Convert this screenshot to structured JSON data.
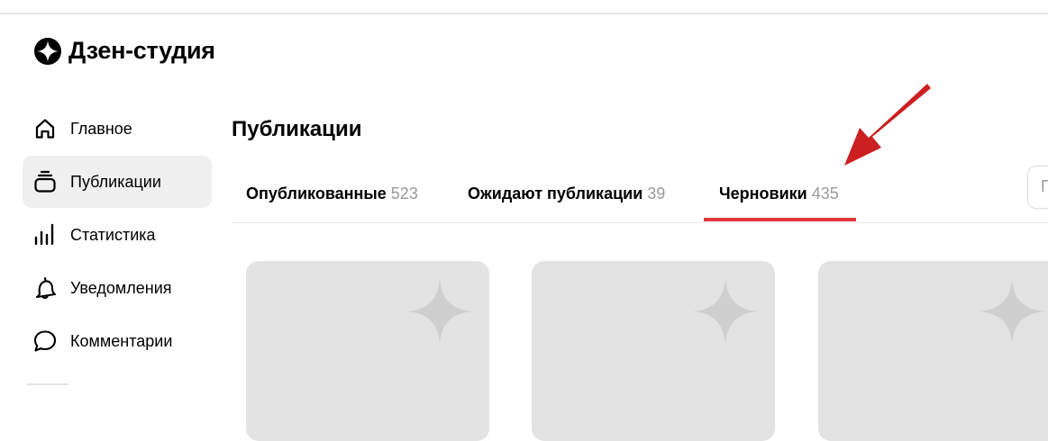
{
  "app": {
    "logo_text": "Дзен-студия"
  },
  "sidebar": {
    "items": [
      {
        "label": "Главное",
        "icon": "home-icon",
        "active": false
      },
      {
        "label": "Публикации",
        "icon": "publications-icon",
        "active": true
      },
      {
        "label": "Статистика",
        "icon": "bar-chart-icon",
        "active": false
      },
      {
        "label": "Уведомления",
        "icon": "bell-icon",
        "active": false
      },
      {
        "label": "Комментарии",
        "icon": "comment-bubble-icon",
        "active": false
      }
    ]
  },
  "main": {
    "title": "Публикации",
    "tabs": [
      {
        "label": "Опубликованные",
        "count": "523",
        "active": false
      },
      {
        "label": "Ожидают публикации",
        "count": "39",
        "active": false
      },
      {
        "label": "Черновики",
        "count": "435",
        "active": true
      }
    ],
    "search_placeholder_visible": "П",
    "cards": [
      {
        "icon": "sparkle-placeholder-icon"
      },
      {
        "icon": "sparkle-placeholder-icon"
      },
      {
        "icon": "sparkle-placeholder-icon"
      }
    ]
  },
  "annotation": {
    "arrow_color": "#cc1f1f",
    "accent_color": "#e3363a"
  }
}
